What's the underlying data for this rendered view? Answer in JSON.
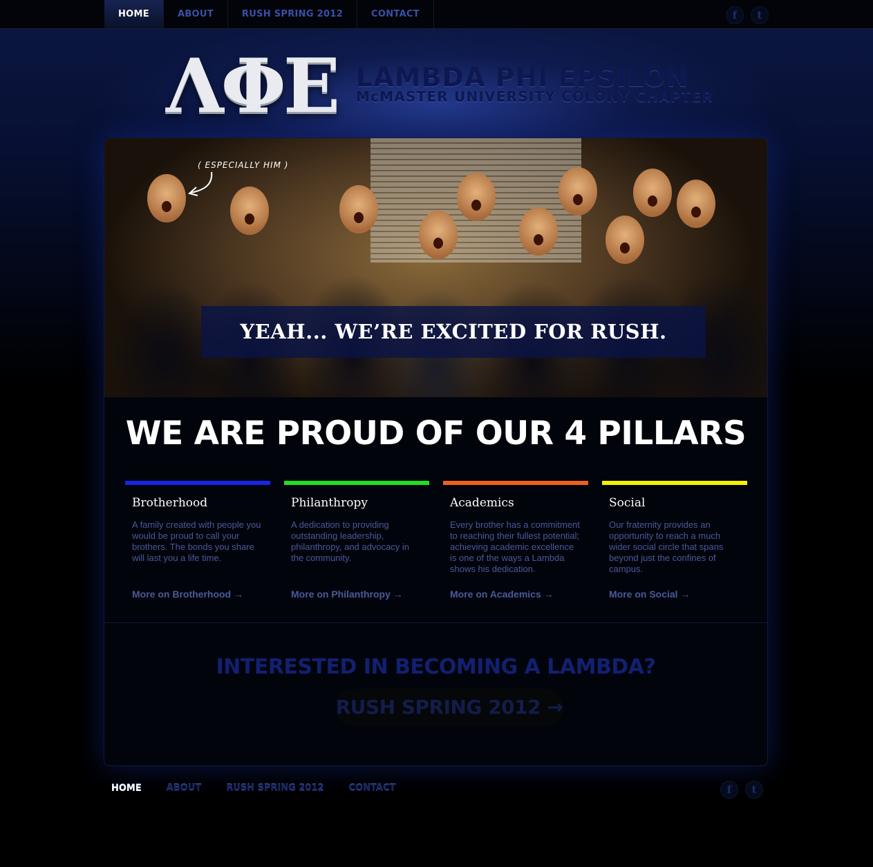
{
  "nav": {
    "items": [
      {
        "label": "HOME",
        "active": true
      },
      {
        "label": "ABOUT",
        "active": false
      },
      {
        "label": "RUSH SPRING 2012",
        "active": false
      },
      {
        "label": "CONTACT",
        "active": false
      }
    ],
    "social": {
      "facebook": "f",
      "twitter": "t"
    }
  },
  "header": {
    "logo_letters": "ΛΦΕ",
    "title": "LAMBDA PHI EPSILON",
    "subtitle": "McMASTER UNIVERSITY COLONY CHAPTER"
  },
  "hero": {
    "callout": "( ESPECIALLY HIM )",
    "caption": "YEAH... WE’RE EXCITED FOR RUSH."
  },
  "pillars": {
    "title": "WE ARE PROUD OF OUR 4 PILLARS",
    "items": [
      {
        "title": "Brotherhood",
        "color": "#1426e6",
        "description": "A family created with people you would be proud to call your brothers. The bonds you share will last you a life time.",
        "more": "More on Brotherhood →"
      },
      {
        "title": "Philanthropy",
        "color": "#1ee01e",
        "description": "A dedication to providing outstanding leadership, philanthropy, and advocacy in the community.",
        "more": "More on Philanthropy →"
      },
      {
        "title": "Academics",
        "color": "#f0601a",
        "description": "Every brother has a commitment to reaching their fullest potential; achieving academic excellence is one of the ways a Lambda shows his dedication.",
        "more": "More on Academics →"
      },
      {
        "title": "Social",
        "color": "#f5f000",
        "description": "Our fraternity provides an opportunity to reach a much wider social circle that spans beyond just the confines of campus.",
        "more": "More on Social →"
      }
    ]
  },
  "cta": {
    "heading": "INTERESTED IN BECOMING A LAMBDA?",
    "button": "RUSH SPRING 2012 →"
  },
  "footer": {
    "items": [
      {
        "label": "HOME",
        "active": true
      },
      {
        "label": "ABOUT",
        "active": false
      },
      {
        "label": "RUSH SPRING 2012",
        "active": false
      },
      {
        "label": "CONTACT",
        "active": false
      }
    ]
  }
}
